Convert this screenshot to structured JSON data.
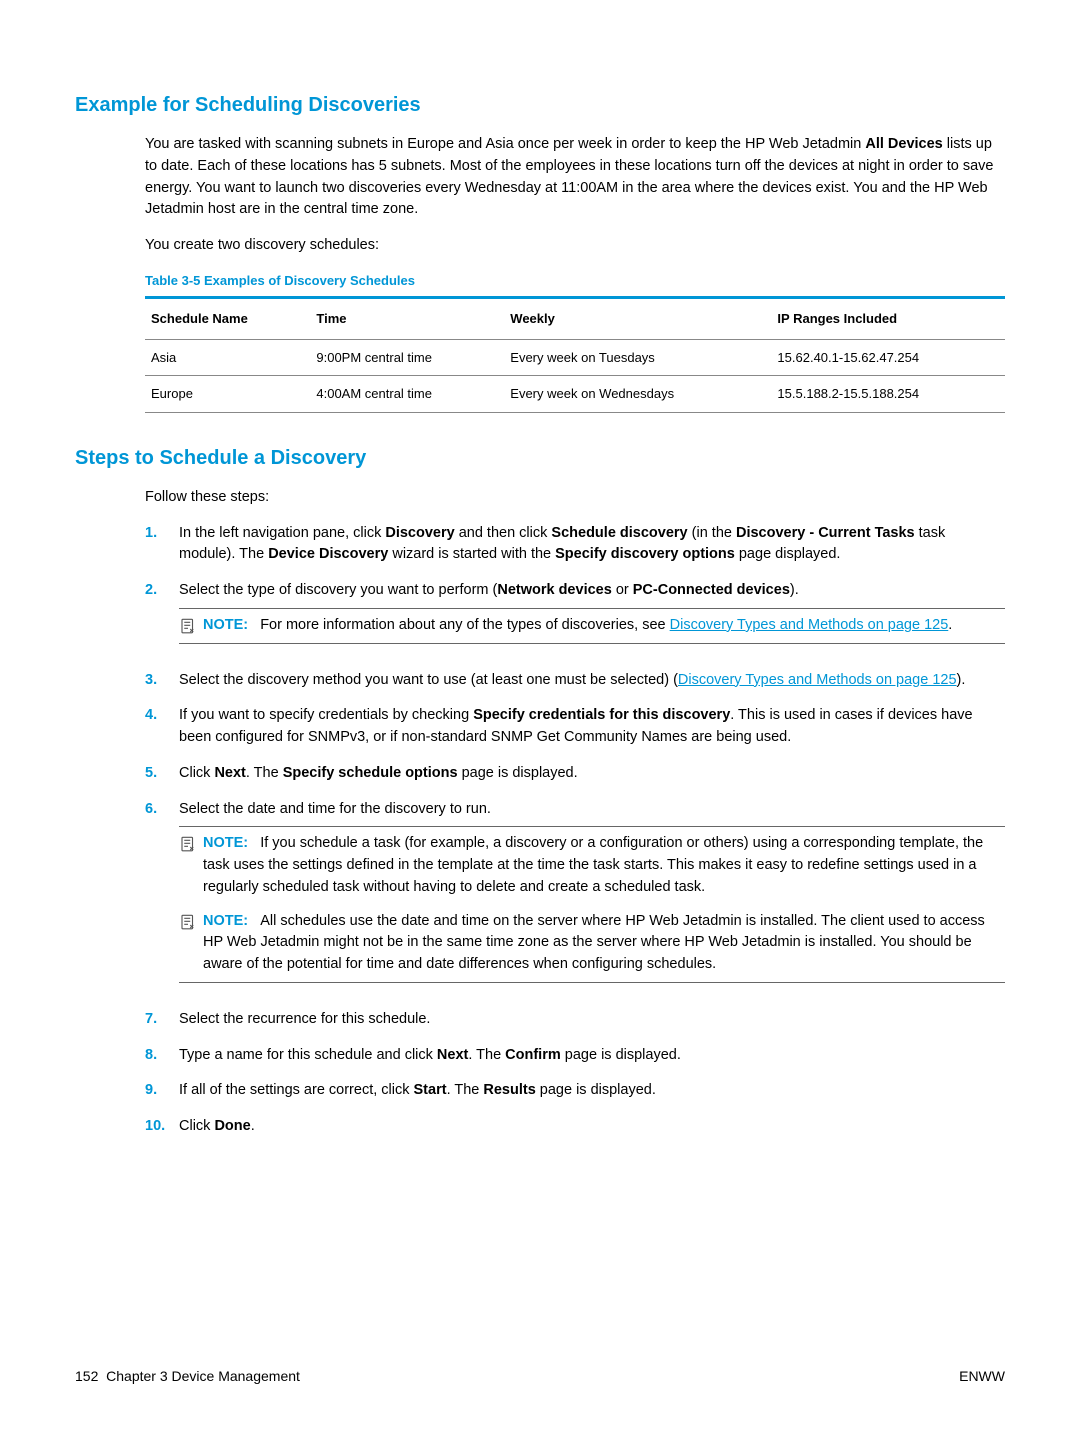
{
  "section1": {
    "heading": "Example for Scheduling Discoveries",
    "para1_a": "You are tasked with scanning subnets in Europe and Asia once per week in order to keep the HP Web Jetadmin ",
    "para1_bold": "All Devices",
    "para1_b": " lists up to date. Each of these locations has 5 subnets. Most of the employees in these locations turn off the devices at night in order to save energy. You want to launch two discoveries every Wednesday at 11:00AM in the area where the devices exist. You and the HP Web Jetadmin host are in the central time zone.",
    "para2": "You create two discovery schedules:",
    "table_title": "Table 3-5  Examples of Discovery Schedules",
    "headers": {
      "c1": "Schedule Name",
      "c2": "Time",
      "c3": "Weekly",
      "c4": "IP Ranges Included"
    },
    "row1": {
      "c1": "Asia",
      "c2": "9:00PM central time",
      "c3": "Every week on Tuesdays",
      "c4": "15.62.40.1-15.62.47.254"
    },
    "row2": {
      "c1": "Europe",
      "c2": "4:00AM central time",
      "c3": "Every week on Wednesdays",
      "c4": "15.5.188.2-15.5.188.254"
    }
  },
  "section2": {
    "heading": "Steps to Schedule a Discovery",
    "intro": "Follow these steps:",
    "step1_a": "In the left navigation pane, click ",
    "step1_b1": "Discovery",
    "step1_c": " and then click ",
    "step1_b2": "Schedule discovery",
    "step1_d": " (in the ",
    "step1_b3": "Discovery - Current Tasks",
    "step1_e": " task module). The ",
    "step1_b4": "Device Discovery",
    "step1_f": " wizard is started with the ",
    "step1_b5": "Specify discovery options",
    "step1_g": " page displayed.",
    "step2_a": "Select the type of discovery you want to perform (",
    "step2_b1": "Network devices",
    "step2_b": " or ",
    "step2_b2": "PC-Connected devices",
    "step2_c": ").",
    "note1_label": "NOTE:",
    "note1_a": "For more information about any of the types of discoveries, see ",
    "note1_link": "Discovery Types and Methods on page 125",
    "note1_b": ".",
    "step3_a": "Select the discovery method you want to use (at least one must be selected) (",
    "step3_link": "Discovery Types and Methods on page 125",
    "step3_b": ").",
    "step4_a": "If you want to specify credentials by checking ",
    "step4_b1": "Specify credentials for this discovery",
    "step4_b": ". This is used in cases if devices have been configured for SNMPv3, or if non-standard SNMP Get Community Names are being used.",
    "step5_a": "Click ",
    "step5_b1": "Next",
    "step5_b": ". The ",
    "step5_b2": "Specify schedule options",
    "step5_c": " page is displayed.",
    "step6": "Select the date and time for the discovery to run.",
    "note2_label": "NOTE:",
    "note2": "If you schedule a task (for example, a discovery or a configuration or others) using a corresponding template, the task uses the settings defined in the template at the time the task starts. This makes it easy to redefine settings used in a regularly scheduled task without having to delete and create a scheduled task.",
    "note3_label": "NOTE:",
    "note3": "All schedules use the date and time on the server where HP Web Jetadmin is installed. The client used to access HP Web Jetadmin might not be in the same time zone as the server where HP Web Jetadmin is installed. You should be aware of the potential for time and date differences when configuring schedules.",
    "step7": "Select the recurrence for this schedule.",
    "step8_a": "Type a name for this schedule and click ",
    "step8_b1": "Next",
    "step8_b": ". The ",
    "step8_b2": "Confirm",
    "step8_c": " page is displayed.",
    "step9_a": "If all of the settings are correct, click ",
    "step9_b1": "Start",
    "step9_b": ". The ",
    "step9_b2": "Results",
    "step9_c": " page is displayed.",
    "step10_a": "Click ",
    "step10_b1": "Done",
    "step10_b": "."
  },
  "footer": {
    "left_page": "152",
    "left_text": "Chapter 3   Device Management",
    "right": "ENWW"
  }
}
